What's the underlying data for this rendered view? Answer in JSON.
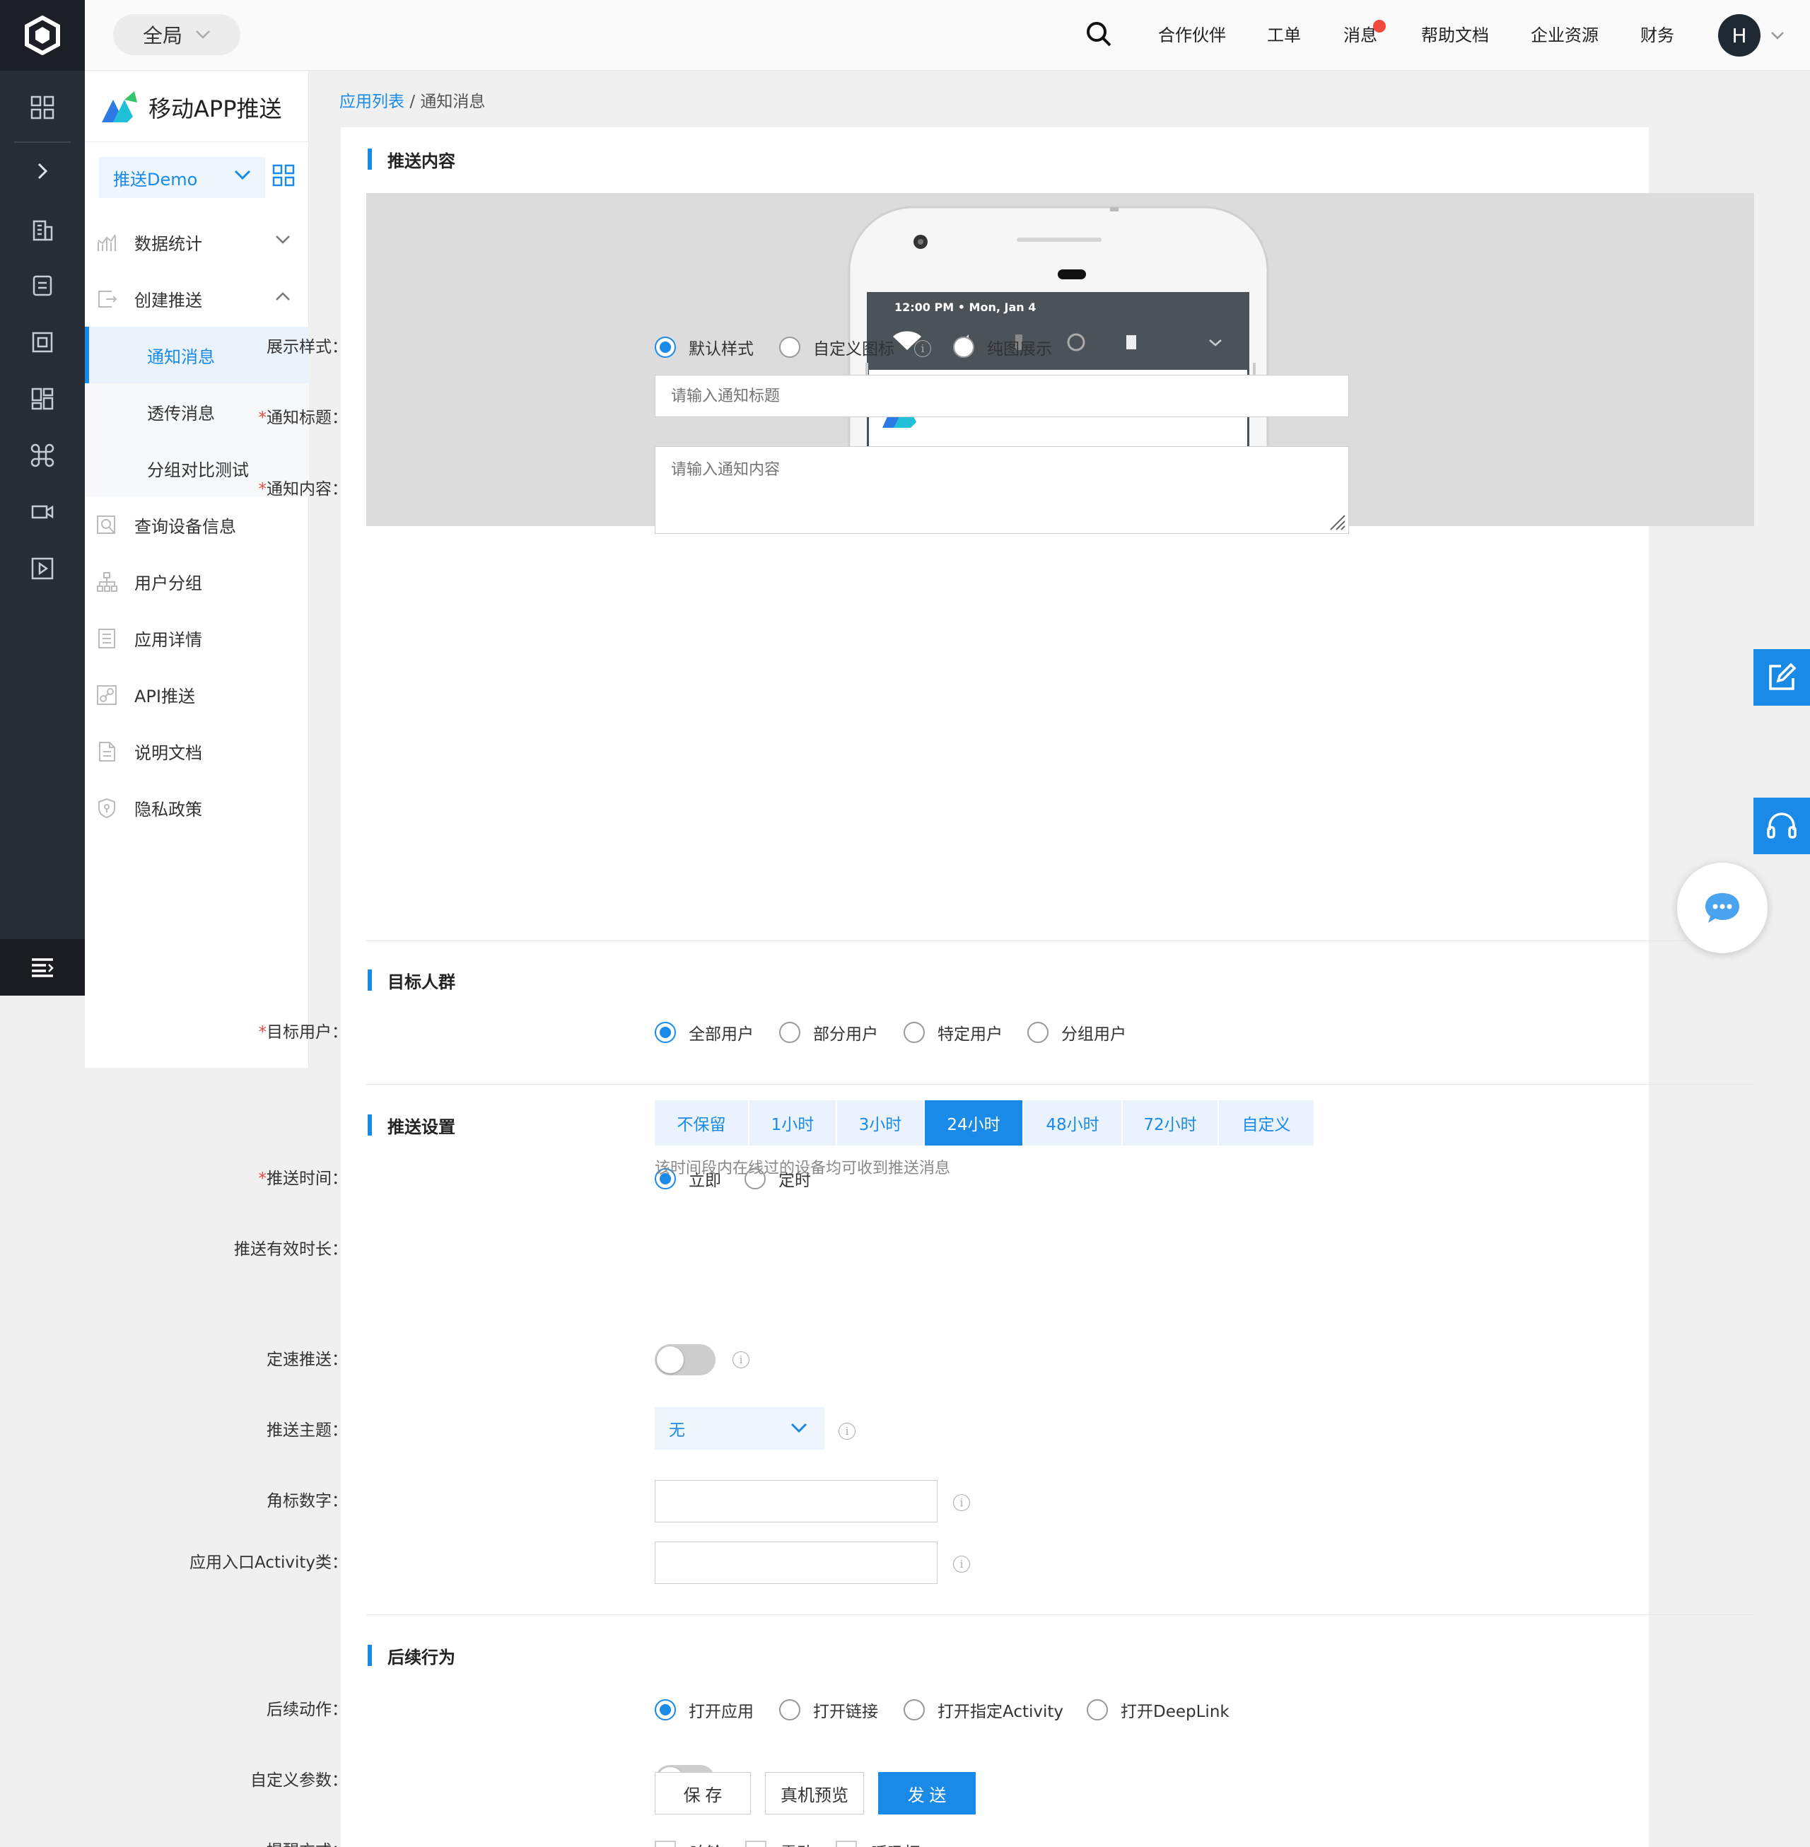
{
  "topbar": {
    "scope": "全局",
    "nav": [
      "合作伙伴",
      "工单",
      "消息",
      "帮助文档",
      "企业资源",
      "财务"
    ],
    "avatar_initial": "H"
  },
  "sidebar": {
    "brand": "移动APP推送",
    "app_selector": "推送Demo",
    "menu": {
      "stats": "数据统计",
      "create": "创建推送",
      "sub_notify": "通知消息",
      "sub_passthrough": "透传消息",
      "sub_abtest": "分组对比测试",
      "device": "查询设备信息",
      "group": "用户分组",
      "detail": "应用详情",
      "api": "API推送",
      "docs": "说明文档",
      "privacy": "隐私政策"
    }
  },
  "breadcrumb": {
    "link": "应用列表",
    "sep": "/",
    "current": "通知消息"
  },
  "preview": {
    "time": "12:00 PM",
    "date": "Mon, Jan 4"
  },
  "sections": {
    "content": "推送内容",
    "target": "目标人群",
    "settings": "推送设置",
    "followup": "后续行为"
  },
  "form": {
    "style_label": "展示样式：",
    "style_options": [
      "默认样式",
      "自定义图标",
      "纯图展示"
    ],
    "title_label": "通知标题：",
    "title_placeholder": "请输入通知标题",
    "body_label": "通知内容：",
    "body_placeholder": "请输入通知内容",
    "target_label": "目标用户：",
    "target_options": [
      "全部用户",
      "部分用户",
      "特定用户",
      "分组用户"
    ],
    "time_label": "推送时间：",
    "time_options": [
      "立即",
      "定时"
    ],
    "ttl_label": "推送有效时长：",
    "ttl_options": [
      "不保留",
      "1小时",
      "3小时",
      "24小时",
      "48小时",
      "72小时",
      "自定义"
    ],
    "ttl_selected": "24小时",
    "ttl_hint": "该时间段内在线过的设备均可收到推送消息",
    "rate_label": "定速推送：",
    "topic_label": "推送主题：",
    "topic_value": "无",
    "badge_label": "角标数字：",
    "activity_label": "应用入口Activity类：",
    "action_label": "后续动作：",
    "action_options": [
      "打开应用",
      "打开链接",
      "打开指定Activity",
      "打开DeepLink"
    ],
    "params_label": "自定义参数：",
    "remind_label": "提醒方式：",
    "remind_options": [
      "响铃",
      "震动",
      "呼吸灯"
    ],
    "required_mark": "*",
    "info_mark": "i"
  },
  "actions": {
    "save": "保 存",
    "preview": "真机预览",
    "send": "发 送"
  },
  "colors": {
    "accent": "#1a8ae8",
    "rail": "#282c34",
    "required": "#e74c3c",
    "badge": "#f04a3c"
  }
}
